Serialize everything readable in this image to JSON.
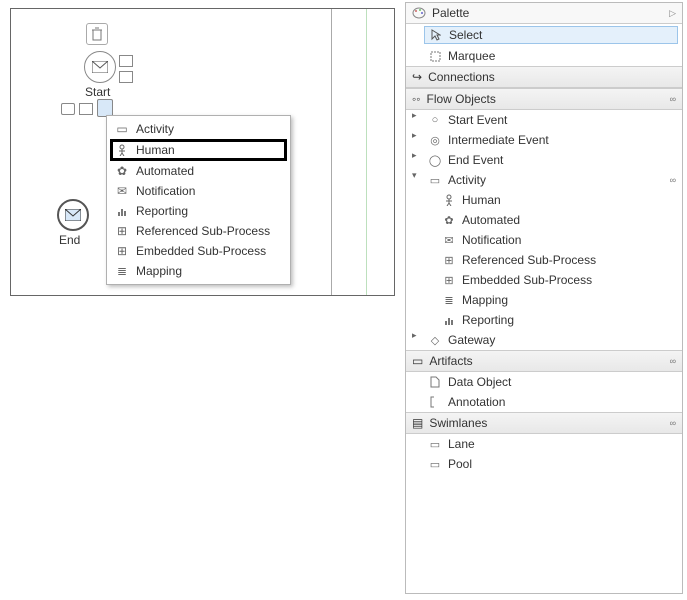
{
  "canvas": {
    "start_label": "Start",
    "end_label": "End"
  },
  "context_menu": {
    "items": [
      {
        "label": "Activity"
      },
      {
        "label": "Human"
      },
      {
        "label": "Automated"
      },
      {
        "label": "Notification"
      },
      {
        "label": "Reporting"
      },
      {
        "label": "Referenced Sub-Process"
      },
      {
        "label": "Embedded Sub-Process"
      },
      {
        "label": "Mapping"
      }
    ]
  },
  "palette": {
    "title": "Palette",
    "tools": {
      "select": "Select",
      "marquee": "Marquee"
    },
    "connections_label": "Connections",
    "flow_objects": {
      "label": "Flow Objects",
      "start_event": "Start Event",
      "intermediate_event": "Intermediate Event",
      "end_event": "End Event",
      "activity": {
        "label": "Activity",
        "human": "Human",
        "automated": "Automated",
        "notification": "Notification",
        "referenced": "Referenced Sub-Process",
        "embedded": "Embedded Sub-Process",
        "mapping": "Mapping",
        "reporting": "Reporting"
      },
      "gateway": "Gateway"
    },
    "artifacts": {
      "label": "Artifacts",
      "data_object": "Data Object",
      "annotation": "Annotation"
    },
    "swimlanes": {
      "label": "Swimlanes",
      "lane": "Lane",
      "pool": "Pool"
    }
  }
}
